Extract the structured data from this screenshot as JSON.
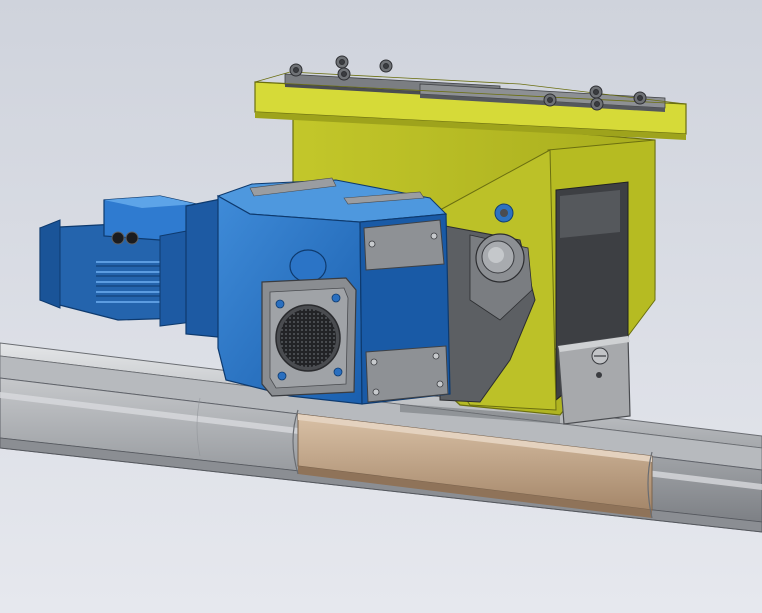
{
  "scene": {
    "background_top": "#cfd3dc",
    "background_bottom": "#e6e8ee",
    "motor_blue": "#1f6fc4",
    "motor_blue_dark": "#124a8a",
    "motor_blue_light": "#4d9ae0",
    "bracket_yellow": "#c8cc2a",
    "bracket_yellow_dark": "#8f9418",
    "plate_yellow": "#d8dc3a",
    "steel_gray": "#8a8d90",
    "steel_dark": "#4a4c50",
    "rail_gray": "#a9acb0",
    "rail_dark": "#6e7176",
    "rail_highlight": "#d9dbdd",
    "rail_bronze": "#b89a7c",
    "bolt_gray": "#6f7276"
  }
}
